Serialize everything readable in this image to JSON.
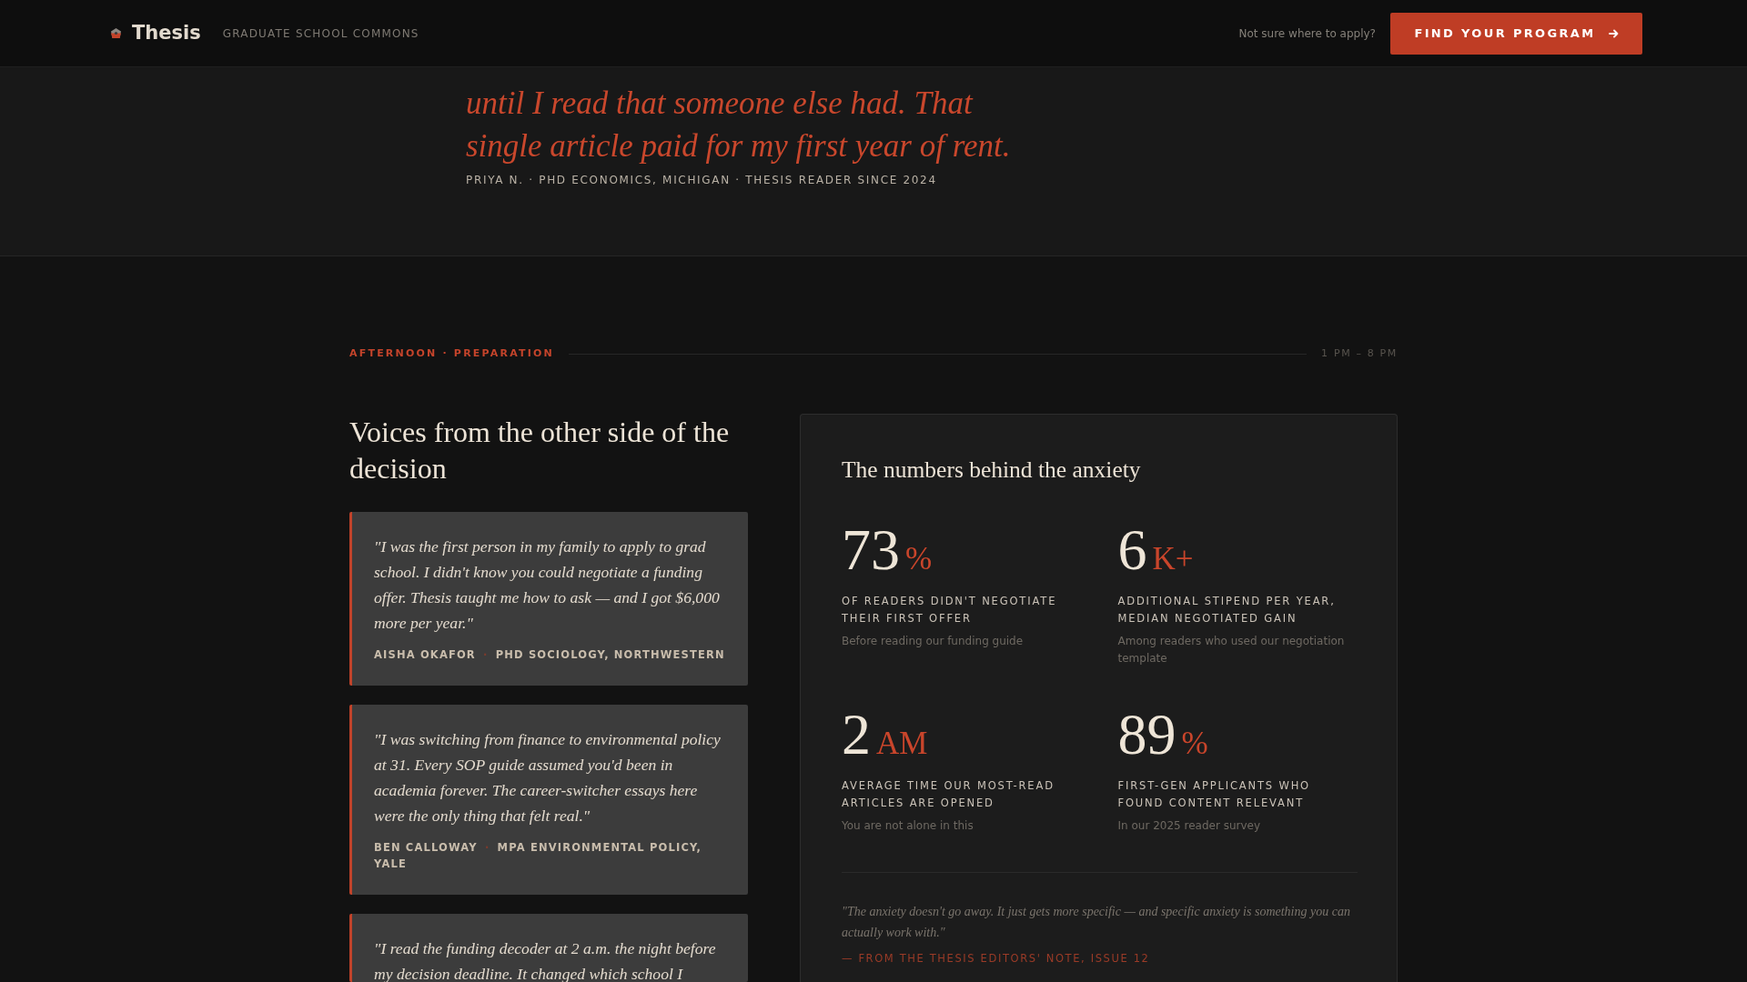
{
  "header": {
    "brand": "Thesis",
    "tagline": "GRADUATE SCHOOL COMMONS",
    "prompt": "Not sure where to apply?",
    "cta_button": "FIND YOUR PROGRAM"
  },
  "featured_quote": {
    "text": "until I read that someone else had. That single article paid for my first year of rent.",
    "attribution": "PRIYA N. · PHD ECONOMICS, MICHIGAN · THESIS READER SINCE 2024"
  },
  "section": {
    "label": "AFTERNOON · PREPARATION",
    "time_range": "1 PM – 8 PM"
  },
  "testimonials": {
    "heading": "Voices from the other side of the decision",
    "items": [
      {
        "quote": "\"I was the first person in my family to apply to grad school. I didn't know you could negotiate a funding offer. Thesis taught me how to ask — and I got $6,000 more per year.\"",
        "name": "AISHA OKAFOR",
        "separator": "·",
        "program": "PHD SOCIOLOGY, NORTHWESTERN"
      },
      {
        "quote": "\"I was switching from finance to environmental policy at 31. Every SOP guide assumed you'd been in academia forever. The career-switcher essays here were the only thing that felt real.\"",
        "name": "BEN CALLOWAY",
        "separator": "·",
        "program": "MPA ENVIRONMENTAL POLICY, YALE"
      },
      {
        "quote": "\"I read the funding decoder at 2 a.m. the night before my decision deadline. It changed which school I"
      }
    ]
  },
  "stats_card": {
    "title": "The numbers behind the anxiety",
    "stats": [
      {
        "value": "73",
        "suffix": "%",
        "label": "OF READERS DIDN'T NEGOTIATE THEIR FIRST OFFER",
        "note": "Before reading our funding guide"
      },
      {
        "value": "6",
        "suffix": "K+",
        "label": "ADDITIONAL STIPEND PER YEAR, MEDIAN NEGOTIATED GAIN",
        "note": "Among readers who used our negotiation template"
      },
      {
        "value": "2",
        "suffix": "AM",
        "label": "AVERAGE TIME OUR MOST-READ ARTICLES ARE OPENED",
        "note": "You are not alone in this"
      },
      {
        "value": "89",
        "suffix": "%",
        "label": "FIRST-GEN APPLICANTS WHO FOUND CONTENT RELEVANT",
        "note": "In our 2025 reader survey"
      }
    ],
    "quote": "\"The anxiety doesn't go away. It just gets more specific — and specific anxiety is something you can actually work with.\"",
    "attribution": "— FROM THE THESIS EDITORS' NOTE, ISSUE 12"
  }
}
